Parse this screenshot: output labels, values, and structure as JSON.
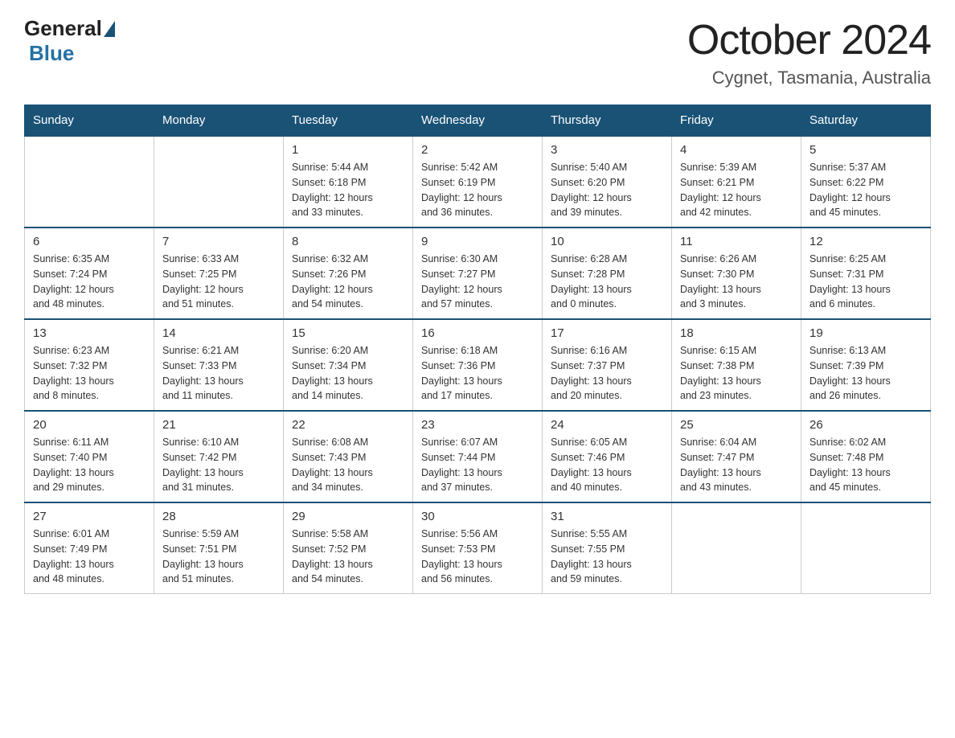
{
  "header": {
    "logo": {
      "general": "General",
      "blue": "Blue"
    },
    "title": "October 2024",
    "location": "Cygnet, Tasmania, Australia"
  },
  "calendar": {
    "days_of_week": [
      "Sunday",
      "Monday",
      "Tuesday",
      "Wednesday",
      "Thursday",
      "Friday",
      "Saturday"
    ],
    "weeks": [
      [
        {
          "day": "",
          "info": ""
        },
        {
          "day": "",
          "info": ""
        },
        {
          "day": "1",
          "info": "Sunrise: 5:44 AM\nSunset: 6:18 PM\nDaylight: 12 hours\nand 33 minutes."
        },
        {
          "day": "2",
          "info": "Sunrise: 5:42 AM\nSunset: 6:19 PM\nDaylight: 12 hours\nand 36 minutes."
        },
        {
          "day": "3",
          "info": "Sunrise: 5:40 AM\nSunset: 6:20 PM\nDaylight: 12 hours\nand 39 minutes."
        },
        {
          "day": "4",
          "info": "Sunrise: 5:39 AM\nSunset: 6:21 PM\nDaylight: 12 hours\nand 42 minutes."
        },
        {
          "day": "5",
          "info": "Sunrise: 5:37 AM\nSunset: 6:22 PM\nDaylight: 12 hours\nand 45 minutes."
        }
      ],
      [
        {
          "day": "6",
          "info": "Sunrise: 6:35 AM\nSunset: 7:24 PM\nDaylight: 12 hours\nand 48 minutes."
        },
        {
          "day": "7",
          "info": "Sunrise: 6:33 AM\nSunset: 7:25 PM\nDaylight: 12 hours\nand 51 minutes."
        },
        {
          "day": "8",
          "info": "Sunrise: 6:32 AM\nSunset: 7:26 PM\nDaylight: 12 hours\nand 54 minutes."
        },
        {
          "day": "9",
          "info": "Sunrise: 6:30 AM\nSunset: 7:27 PM\nDaylight: 12 hours\nand 57 minutes."
        },
        {
          "day": "10",
          "info": "Sunrise: 6:28 AM\nSunset: 7:28 PM\nDaylight: 13 hours\nand 0 minutes."
        },
        {
          "day": "11",
          "info": "Sunrise: 6:26 AM\nSunset: 7:30 PM\nDaylight: 13 hours\nand 3 minutes."
        },
        {
          "day": "12",
          "info": "Sunrise: 6:25 AM\nSunset: 7:31 PM\nDaylight: 13 hours\nand 6 minutes."
        }
      ],
      [
        {
          "day": "13",
          "info": "Sunrise: 6:23 AM\nSunset: 7:32 PM\nDaylight: 13 hours\nand 8 minutes."
        },
        {
          "day": "14",
          "info": "Sunrise: 6:21 AM\nSunset: 7:33 PM\nDaylight: 13 hours\nand 11 minutes."
        },
        {
          "day": "15",
          "info": "Sunrise: 6:20 AM\nSunset: 7:34 PM\nDaylight: 13 hours\nand 14 minutes."
        },
        {
          "day": "16",
          "info": "Sunrise: 6:18 AM\nSunset: 7:36 PM\nDaylight: 13 hours\nand 17 minutes."
        },
        {
          "day": "17",
          "info": "Sunrise: 6:16 AM\nSunset: 7:37 PM\nDaylight: 13 hours\nand 20 minutes."
        },
        {
          "day": "18",
          "info": "Sunrise: 6:15 AM\nSunset: 7:38 PM\nDaylight: 13 hours\nand 23 minutes."
        },
        {
          "day": "19",
          "info": "Sunrise: 6:13 AM\nSunset: 7:39 PM\nDaylight: 13 hours\nand 26 minutes."
        }
      ],
      [
        {
          "day": "20",
          "info": "Sunrise: 6:11 AM\nSunset: 7:40 PM\nDaylight: 13 hours\nand 29 minutes."
        },
        {
          "day": "21",
          "info": "Sunrise: 6:10 AM\nSunset: 7:42 PM\nDaylight: 13 hours\nand 31 minutes."
        },
        {
          "day": "22",
          "info": "Sunrise: 6:08 AM\nSunset: 7:43 PM\nDaylight: 13 hours\nand 34 minutes."
        },
        {
          "day": "23",
          "info": "Sunrise: 6:07 AM\nSunset: 7:44 PM\nDaylight: 13 hours\nand 37 minutes."
        },
        {
          "day": "24",
          "info": "Sunrise: 6:05 AM\nSunset: 7:46 PM\nDaylight: 13 hours\nand 40 minutes."
        },
        {
          "day": "25",
          "info": "Sunrise: 6:04 AM\nSunset: 7:47 PM\nDaylight: 13 hours\nand 43 minutes."
        },
        {
          "day": "26",
          "info": "Sunrise: 6:02 AM\nSunset: 7:48 PM\nDaylight: 13 hours\nand 45 minutes."
        }
      ],
      [
        {
          "day": "27",
          "info": "Sunrise: 6:01 AM\nSunset: 7:49 PM\nDaylight: 13 hours\nand 48 minutes."
        },
        {
          "day": "28",
          "info": "Sunrise: 5:59 AM\nSunset: 7:51 PM\nDaylight: 13 hours\nand 51 minutes."
        },
        {
          "day": "29",
          "info": "Sunrise: 5:58 AM\nSunset: 7:52 PM\nDaylight: 13 hours\nand 54 minutes."
        },
        {
          "day": "30",
          "info": "Sunrise: 5:56 AM\nSunset: 7:53 PM\nDaylight: 13 hours\nand 56 minutes."
        },
        {
          "day": "31",
          "info": "Sunrise: 5:55 AM\nSunset: 7:55 PM\nDaylight: 13 hours\nand 59 minutes."
        },
        {
          "day": "",
          "info": ""
        },
        {
          "day": "",
          "info": ""
        }
      ]
    ]
  }
}
